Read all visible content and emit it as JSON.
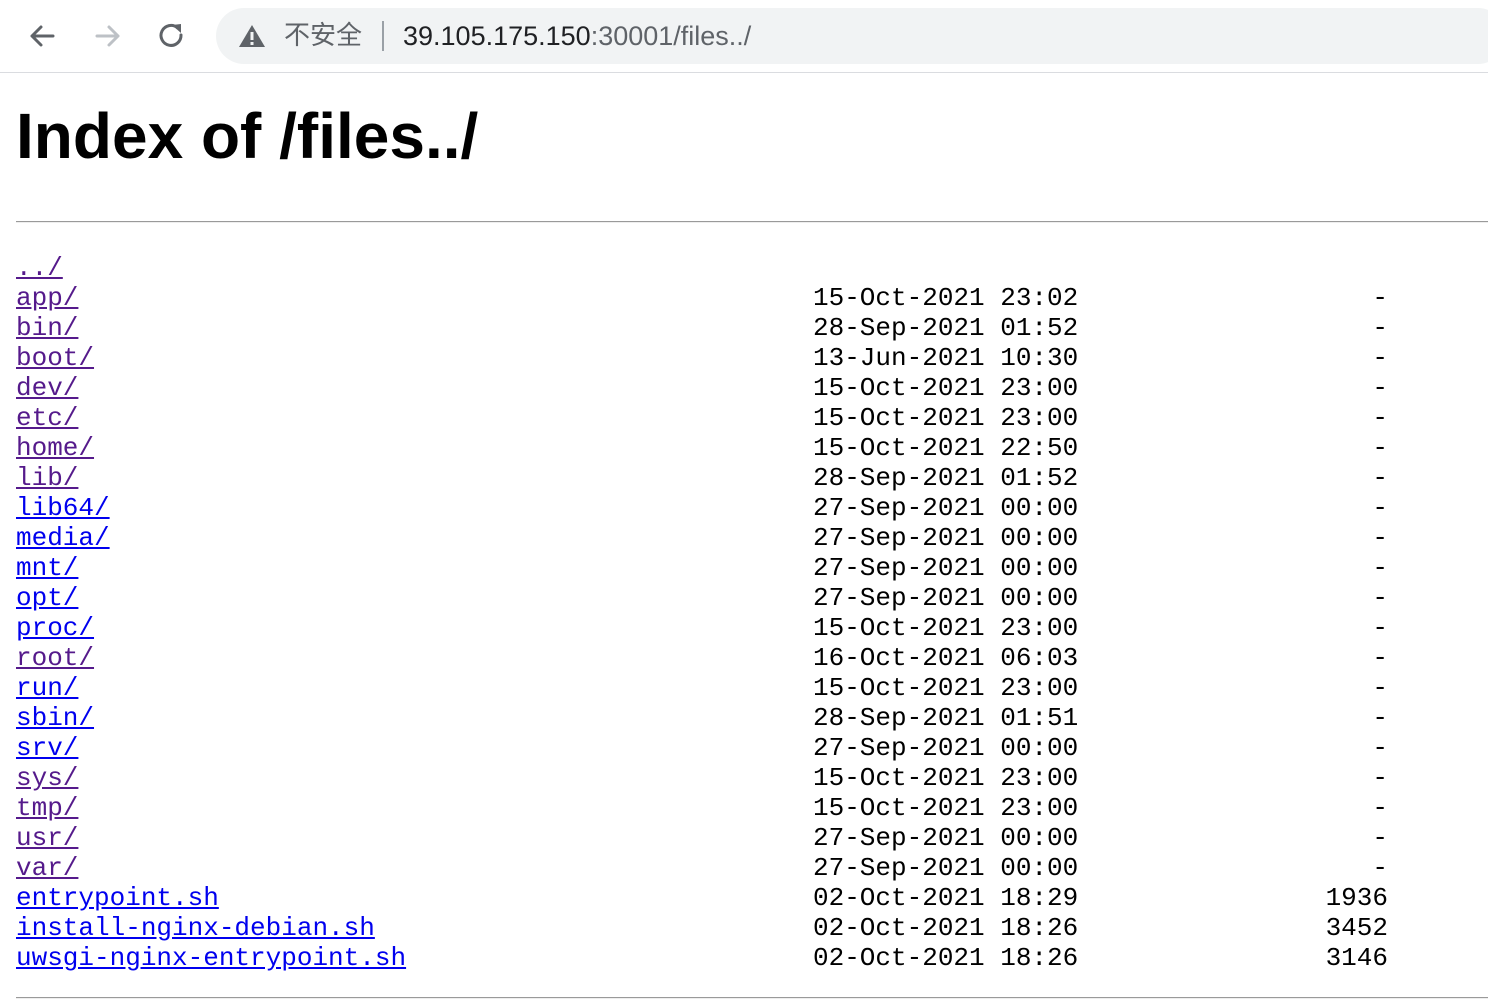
{
  "browser": {
    "security_label": "不安全",
    "url_host": "39.105.175.150",
    "url_path": ":30001/files../",
    "icons": {
      "back": "arrow-left-icon",
      "forward": "arrow-right-icon",
      "reload": "reload-icon",
      "security": "warning-triangle-icon"
    }
  },
  "page": {
    "title": "Index of /files../"
  },
  "listing": {
    "parent": {
      "name": "../"
    },
    "entries": [
      {
        "name": "app/",
        "date": "15-Oct-2021 23:02",
        "size": "-",
        "visited": true
      },
      {
        "name": "bin/",
        "date": "28-Sep-2021 01:52",
        "size": "-",
        "visited": true
      },
      {
        "name": "boot/",
        "date": "13-Jun-2021 10:30",
        "size": "-",
        "visited": true
      },
      {
        "name": "dev/",
        "date": "15-Oct-2021 23:00",
        "size": "-",
        "visited": true
      },
      {
        "name": "etc/",
        "date": "15-Oct-2021 23:00",
        "size": "-",
        "visited": true
      },
      {
        "name": "home/",
        "date": "15-Oct-2021 22:50",
        "size": "-",
        "visited": true
      },
      {
        "name": "lib/",
        "date": "28-Sep-2021 01:52",
        "size": "-",
        "visited": true
      },
      {
        "name": "lib64/",
        "date": "27-Sep-2021 00:00",
        "size": "-",
        "visited": false
      },
      {
        "name": "media/",
        "date": "27-Sep-2021 00:00",
        "size": "-",
        "visited": false
      },
      {
        "name": "mnt/",
        "date": "27-Sep-2021 00:00",
        "size": "-",
        "visited": false
      },
      {
        "name": "opt/",
        "date": "27-Sep-2021 00:00",
        "size": "-",
        "visited": false
      },
      {
        "name": "proc/",
        "date": "15-Oct-2021 23:00",
        "size": "-",
        "visited": false
      },
      {
        "name": "root/",
        "date": "16-Oct-2021 06:03",
        "size": "-",
        "visited": true
      },
      {
        "name": "run/",
        "date": "15-Oct-2021 23:00",
        "size": "-",
        "visited": false
      },
      {
        "name": "sbin/",
        "date": "28-Sep-2021 01:51",
        "size": "-",
        "visited": false
      },
      {
        "name": "srv/",
        "date": "27-Sep-2021 00:00",
        "size": "-",
        "visited": false
      },
      {
        "name": "sys/",
        "date": "15-Oct-2021 23:00",
        "size": "-",
        "visited": true
      },
      {
        "name": "tmp/",
        "date": "15-Oct-2021 23:00",
        "size": "-",
        "visited": true
      },
      {
        "name": "usr/",
        "date": "27-Sep-2021 00:00",
        "size": "-",
        "visited": true
      },
      {
        "name": "var/",
        "date": "27-Sep-2021 00:00",
        "size": "-",
        "visited": true
      },
      {
        "name": "entrypoint.sh",
        "date": "02-Oct-2021 18:29",
        "size": "1936",
        "visited": false
      },
      {
        "name": "install-nginx-debian.sh",
        "date": "02-Oct-2021 18:26",
        "size": "3452",
        "visited": false
      },
      {
        "name": "uwsgi-nginx-entrypoint.sh",
        "date": "02-Oct-2021 18:26",
        "size": "3146",
        "visited": false
      }
    ]
  },
  "colors": {
    "link_unvisited": "#0000ee",
    "link_visited": "#551a8b",
    "omnibox_bg": "#f1f3f4"
  }
}
